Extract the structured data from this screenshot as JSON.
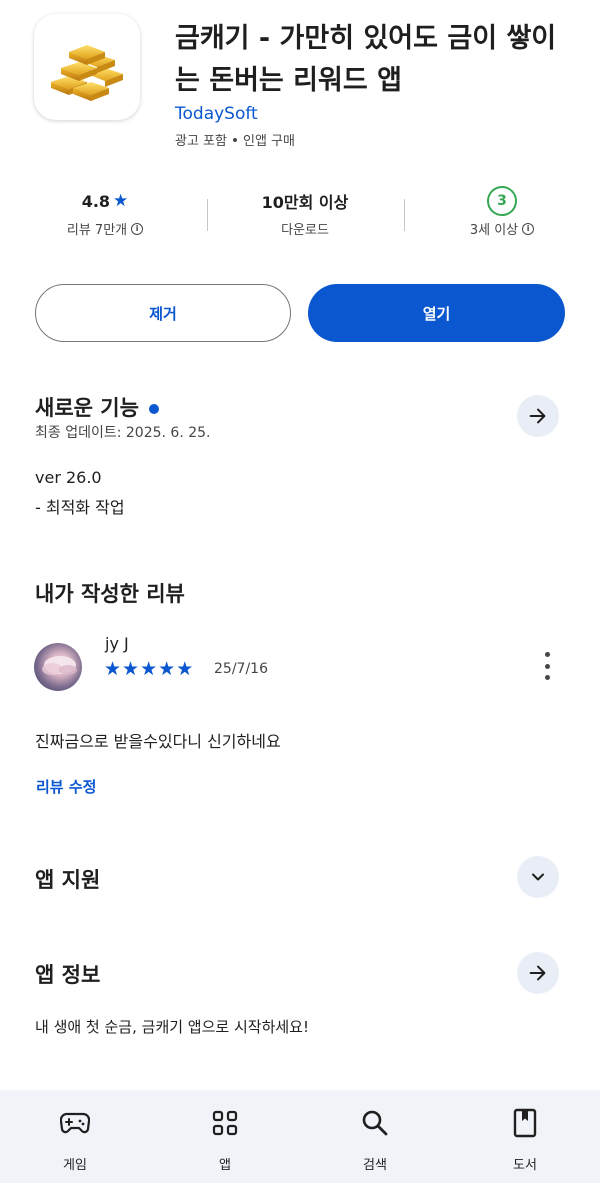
{
  "app": {
    "title": "금캐기 - 가만히 있어도 금이 쌓이는 돈버는 리워드 앱",
    "developer": "TodaySoft",
    "meta": [
      "광고 포함",
      "인앱 구매"
    ],
    "icon": "gold-bars-icon"
  },
  "stats": {
    "rating": "4.8",
    "reviews": "리뷰 7만개",
    "downloads": "10만회 이상",
    "downloads_label": "다운로드",
    "age_badge": "3",
    "age_label": "3세 이상"
  },
  "buttons": {
    "remove": "제거",
    "open": "열기"
  },
  "whats_new": {
    "title": "새로운 기능",
    "updated": "최종 업데이트: 2025. 6. 25.",
    "version": "ver 26.0",
    "note": "- 최적화 작업"
  },
  "my_review": {
    "title": "내가 작성한 리뷰",
    "reviewer": "jy J",
    "stars": 5,
    "date": "25/7/16",
    "text": "진짜금으로 받을수있다니 신기하네요",
    "edit": "리뷰 수정"
  },
  "app_support": {
    "title": "앱 지원"
  },
  "app_info": {
    "title": "앱 정보",
    "description": "내 생애 첫 순금, 금캐기 앱으로 시작하세요!"
  },
  "nav": {
    "items": [
      {
        "label": "게임",
        "icon": "gamepad-icon"
      },
      {
        "label": "앱",
        "icon": "apps-grid-icon"
      },
      {
        "label": "검색",
        "icon": "search-icon"
      },
      {
        "label": "도서",
        "icon": "book-icon"
      }
    ]
  },
  "colors": {
    "accent": "#0b57d0",
    "age_badge": "#34a853",
    "nav_background": "#f0f4f9"
  }
}
